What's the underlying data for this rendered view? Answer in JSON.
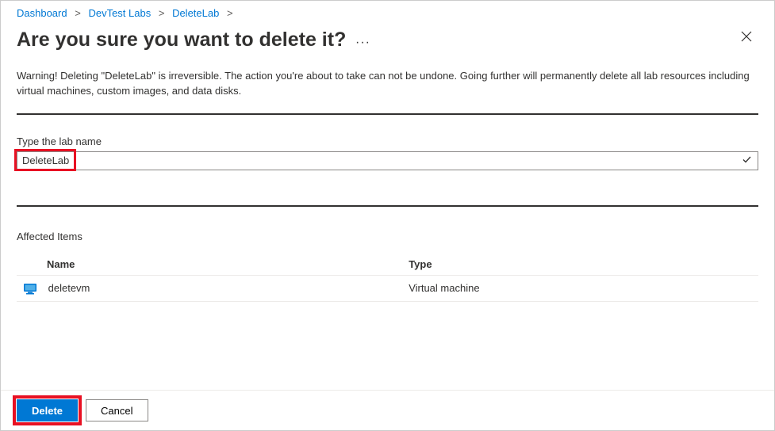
{
  "breadcrumb": {
    "items": [
      {
        "label": "Dashboard"
      },
      {
        "label": "DevTest Labs"
      },
      {
        "label": "DeleteLab"
      }
    ]
  },
  "header": {
    "title": "Are you sure you want to delete it?"
  },
  "warning": "Warning! Deleting \"DeleteLab\" is irreversible. The action you're about to take can not be undone. Going further will permanently delete all lab resources including virtual machines, custom images, and data disks.",
  "labInput": {
    "label": "Type the lab name",
    "value": "DeleteLab"
  },
  "affected": {
    "title": "Affected Items",
    "columns": {
      "name": "Name",
      "type": "Type"
    },
    "rows": [
      {
        "name": "deletevm",
        "type": "Virtual machine"
      }
    ]
  },
  "buttons": {
    "delete": "Delete",
    "cancel": "Cancel"
  }
}
